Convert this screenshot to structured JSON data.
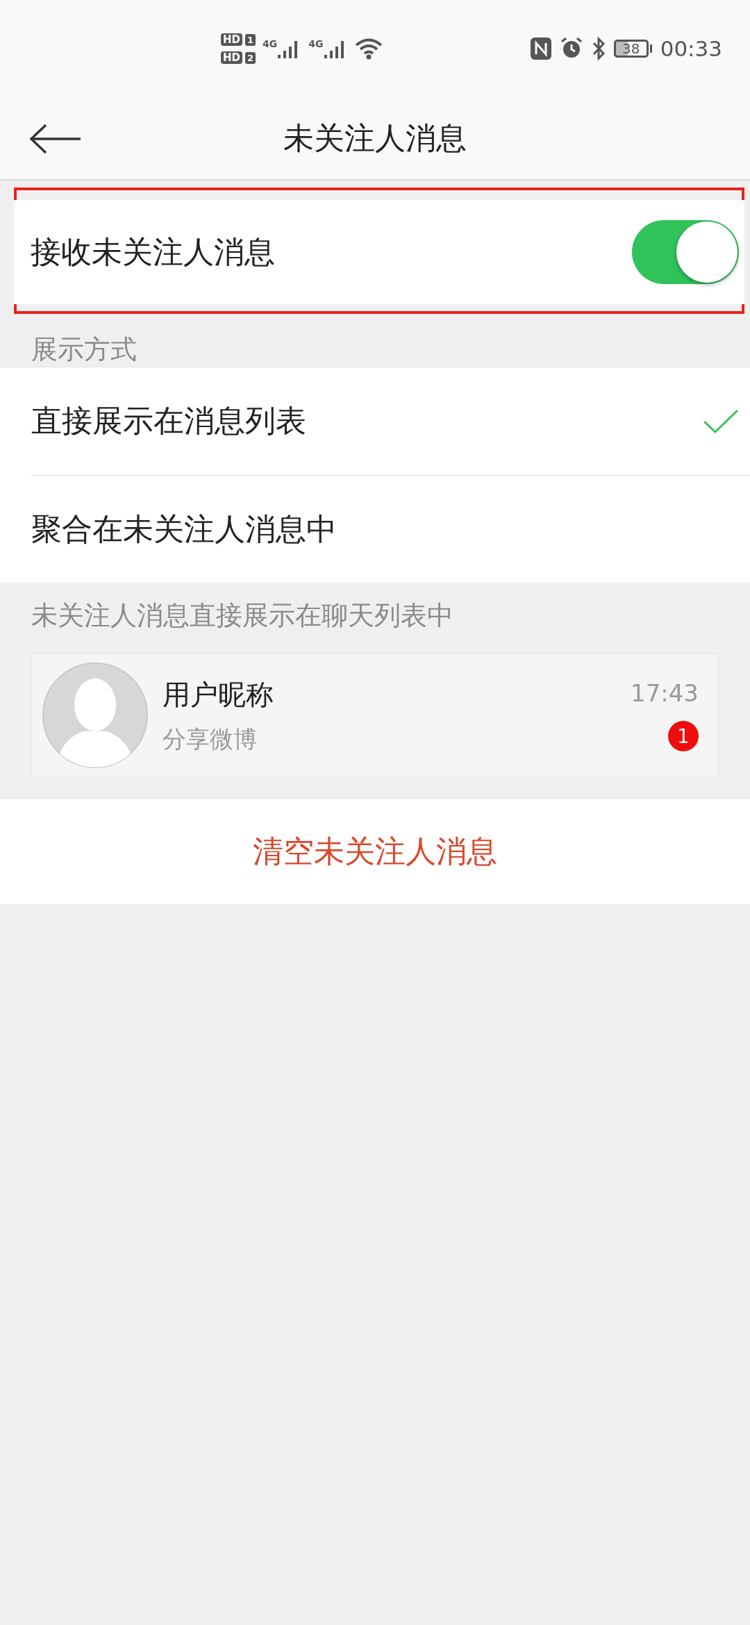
{
  "status_bar": {
    "sim_badges": [
      {
        "label": "HD",
        "slot": "1"
      },
      {
        "label": "HD",
        "slot": "2"
      }
    ],
    "networks": [
      "4G",
      "4G"
    ],
    "battery": "38",
    "time": "00:33"
  },
  "header": {
    "title": "未关注人消息"
  },
  "receive_toggle": {
    "label": "接收未关注人消息",
    "on": true,
    "highlighted": true
  },
  "display_mode": {
    "heading": "展示方式",
    "options": [
      {
        "label": "直接展示在消息列表",
        "selected": true
      },
      {
        "label": "聚合在未关注人消息中",
        "selected": false
      }
    ]
  },
  "preview": {
    "heading": "未关注人消息直接展示在聊天列表中",
    "conversation": {
      "name": "用户昵称",
      "message": "分享微博",
      "time": "17:43",
      "unread": "1"
    }
  },
  "clear_button": {
    "label": "清空未关注人消息"
  }
}
